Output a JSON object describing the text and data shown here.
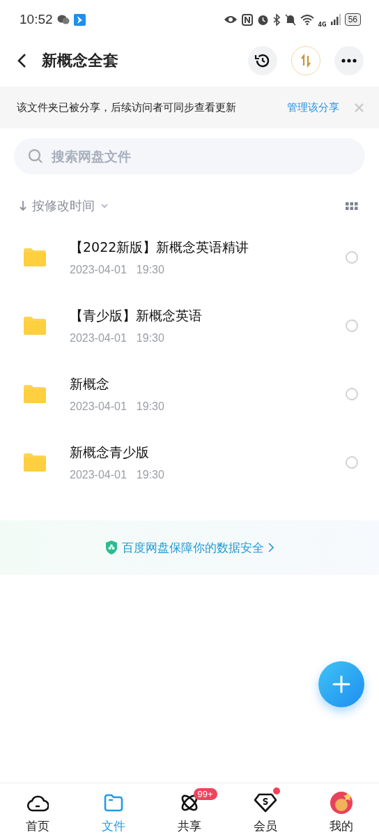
{
  "status_bar": {
    "time": "10:52",
    "network": "4G",
    "battery": "56"
  },
  "header": {
    "title": "新概念全套"
  },
  "banner": {
    "text": "该文件夹已被分享，后续访问者可同步查看更新",
    "link": "管理该分享"
  },
  "search": {
    "placeholder": "搜索网盘文件"
  },
  "sort": {
    "label": "按修改时间"
  },
  "files": [
    {
      "name": "【2022新版】新概念英语精讲",
      "date": "2023-04-01",
      "time": "19:30",
      "selected": false
    },
    {
      "name": "【青少版】新概念英语",
      "date": "2023-04-01",
      "time": "19:30",
      "selected": false
    },
    {
      "name": "新概念",
      "date": "2023-04-01",
      "time": "19:30",
      "selected": false
    },
    {
      "name": "新概念青少版",
      "date": "2023-04-01",
      "time": "19:30",
      "selected": false
    }
  ],
  "security_note": {
    "text": "百度网盘保障你的数据安全"
  },
  "bottom_nav": [
    {
      "label": "首页",
      "selected": false
    },
    {
      "label": "文件",
      "selected": true
    },
    {
      "label": "共享",
      "selected": false,
      "badge": "99+"
    },
    {
      "label": "会员",
      "selected": false,
      "dot": true
    },
    {
      "label": "我的",
      "selected": false
    }
  ]
}
